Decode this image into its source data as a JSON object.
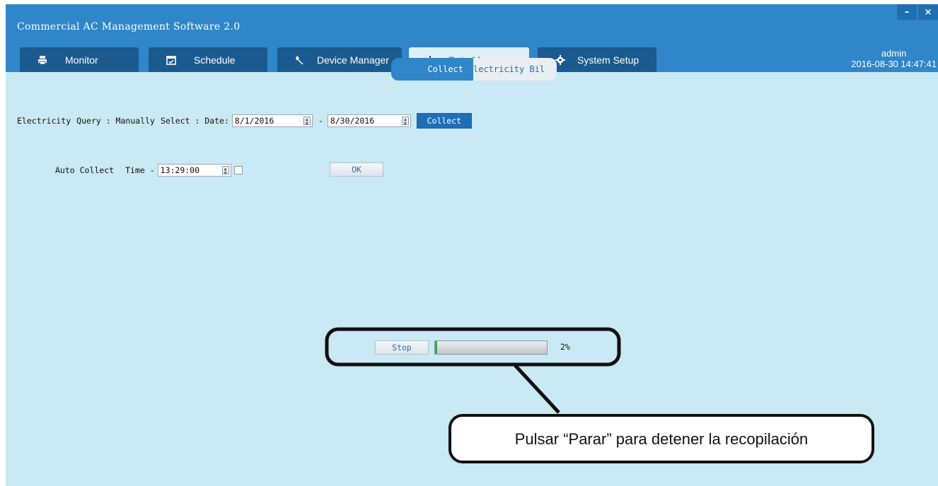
{
  "window": {
    "title": "Commercial AC Management Software 2.0",
    "minimize_symbol": "–",
    "close_symbol": "×"
  },
  "tabs": [
    {
      "label": "Monitor",
      "icon": "printer-icon"
    },
    {
      "label": "Schedule",
      "icon": "calendar-icon"
    },
    {
      "label": "Device Manager",
      "icon": "wrench-icon"
    },
    {
      "label": "Data Manage",
      "icon": "bar-chart-icon",
      "active": true
    },
    {
      "label": "System Setup",
      "icon": "gear-icon"
    }
  ],
  "user": {
    "name": "admin",
    "datetime": "2016-08-30 14:47:41"
  },
  "subtabs": {
    "collect": "Collect",
    "bill": "lectricity Bil"
  },
  "query": {
    "electricity": "Electricity",
    "query_label": "Query : Manually",
    "select_label": "Select : Date:",
    "start_date": "8/1/2016",
    "separator": "-",
    "end_date": "8/30/2016",
    "collect_button": "Collect"
  },
  "auto": {
    "label": "Auto Collect",
    "time_label": "Time -",
    "time_value": "13:29:00",
    "ok_button": "OK"
  },
  "progress": {
    "stop_button": "Stop",
    "percent_text": "2%",
    "percent_value": 2
  },
  "annotation": {
    "text": "Pulsar “Parar” para detener la recopilación"
  },
  "colors": {
    "title_bar": "#2f86c8",
    "tab_inactive": "#1b5a8e",
    "content_bg": "#c9e9f4",
    "progress_fill": "#30b050"
  }
}
